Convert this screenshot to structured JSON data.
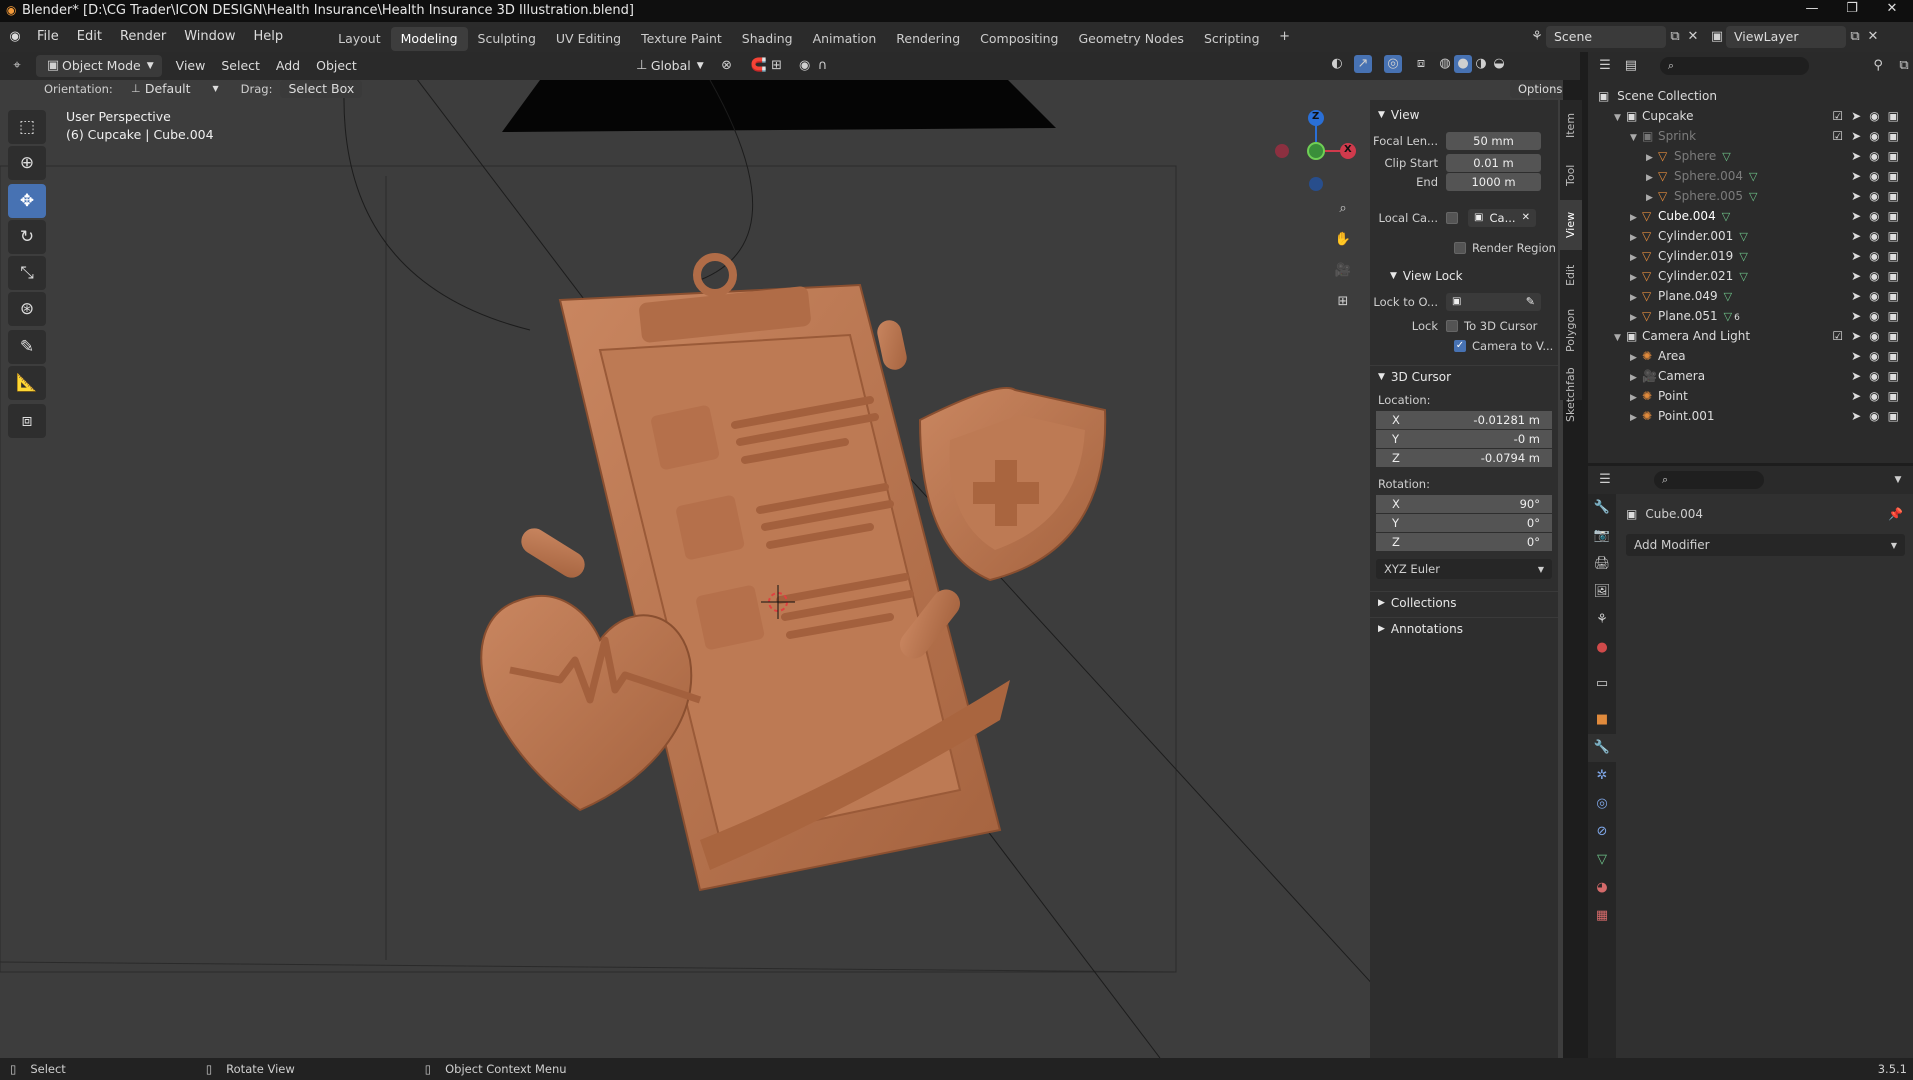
{
  "window": {
    "title": "Blender* [D:\\CG Trader\\ICON DESIGN\\Health Insurance\\Health Insurance 3D Illustration.blend]",
    "minimize": "—",
    "maximize": "❐",
    "close": "✕"
  },
  "menu": [
    "File",
    "Edit",
    "Render",
    "Window",
    "Help"
  ],
  "workspaces": [
    "Layout",
    "Modeling",
    "Sculpting",
    "UV Editing",
    "Texture Paint",
    "Shading",
    "Animation",
    "Rendering",
    "Compositing",
    "Geometry Nodes",
    "Scripting"
  ],
  "active_workspace": "Modeling",
  "scene": {
    "label": "Scene",
    "viewlayer": "ViewLayer"
  },
  "viewport_header": {
    "mode": "Object Mode",
    "menus": [
      "View",
      "Select",
      "Add",
      "Object"
    ],
    "transform_orientation": "Global",
    "orientation_label": "Orientation:",
    "orientation_value": "Default",
    "drag_label": "Drag:",
    "drag_value": "Select Box",
    "options": "Options"
  },
  "viewport_info": {
    "perspective": "User Perspective",
    "object": "(6) Cupcake | Cube.004"
  },
  "gizmo": {
    "z": "Z",
    "x": "X"
  },
  "npanel": {
    "tabs": [
      "Item",
      "Tool",
      "View",
      "Edit",
      "Polygon",
      "Sketchfab"
    ],
    "active_tab": "View",
    "view_section": "View",
    "focal_label": "Focal Len...",
    "focal_value": "50 mm",
    "clip_start_label": "Clip Start",
    "clip_start_value": "0.01 m",
    "clip_end_label": "End",
    "clip_end_value": "1000 m",
    "local_camera_label": "Local Ca...",
    "local_camera_value": "Ca...",
    "render_region": "Render Region",
    "view_lock_section": "View Lock",
    "lock_to_label": "Lock to O...",
    "lock_label": "Lock",
    "to_3d_cursor": "To 3D Cursor",
    "camera_to_view": "Camera to V...",
    "cursor_section": "3D Cursor",
    "location_label": "Location:",
    "loc_x": "-0.01281 m",
    "loc_y": "-0 m",
    "loc_z": "-0.0794 m",
    "rotation_label": "Rotation:",
    "rot_x": "90°",
    "rot_y": "0°",
    "rot_z": "0°",
    "rotation_mode": "XYZ Euler",
    "collections": "Collections",
    "annotations": "Annotations",
    "axis_x": "X",
    "axis_y": "Y",
    "axis_z": "Z"
  },
  "outliner": {
    "root": "Scene Collection",
    "rows": [
      {
        "name": "Cupcake",
        "indent": 1,
        "type": "collection",
        "state": "normal"
      },
      {
        "name": "Sprink",
        "indent": 2,
        "type": "collection",
        "state": "dim"
      },
      {
        "name": "Sphere",
        "indent": 3,
        "type": "mesh",
        "state": "dim"
      },
      {
        "name": "Sphere.004",
        "indent": 3,
        "type": "mesh",
        "state": "dim"
      },
      {
        "name": "Sphere.005",
        "indent": 3,
        "type": "mesh",
        "state": "dim"
      },
      {
        "name": "Cube.004",
        "indent": 2,
        "type": "mesh",
        "state": "sel"
      },
      {
        "name": "Cylinder.001",
        "indent": 2,
        "type": "mesh",
        "state": "normal"
      },
      {
        "name": "Cylinder.019",
        "indent": 2,
        "type": "mesh",
        "state": "normal"
      },
      {
        "name": "Cylinder.021",
        "indent": 2,
        "type": "mesh",
        "state": "normal"
      },
      {
        "name": "Plane.049",
        "indent": 2,
        "type": "mesh",
        "state": "normal"
      },
      {
        "name": "Plane.051",
        "indent": 2,
        "type": "mesh",
        "state": "normal"
      },
      {
        "name": "Camera And Light",
        "indent": 1,
        "type": "collection",
        "state": "normal"
      },
      {
        "name": "Area",
        "indent": 2,
        "type": "light",
        "state": "normal"
      },
      {
        "name": "Camera",
        "indent": 2,
        "type": "camera",
        "state": "normal"
      },
      {
        "name": "Point",
        "indent": 2,
        "type": "light",
        "state": "normal"
      },
      {
        "name": "Point.001",
        "indent": 2,
        "type": "light",
        "state": "normal"
      }
    ],
    "plane_051_badge": "6"
  },
  "properties": {
    "object_name": "Cube.004",
    "add_modifier": "Add Modifier"
  },
  "statusbar": {
    "select": "Select",
    "rotate": "Rotate View",
    "context": "Object Context Menu",
    "version": "3.5.1"
  },
  "colors": {
    "accent": "#4772b3",
    "model": "#b97650",
    "viewport_bg": "#3d3d3d"
  }
}
